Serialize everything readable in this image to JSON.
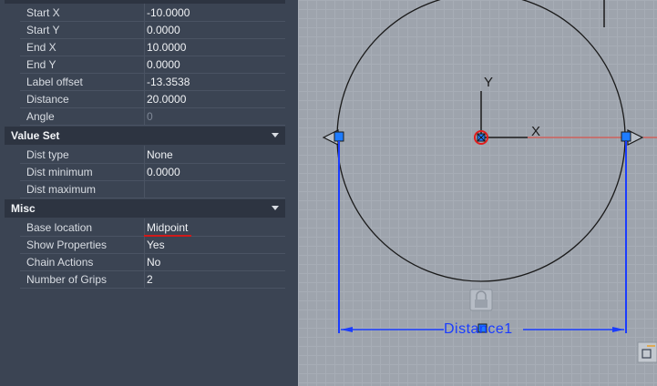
{
  "properties": {
    "rows_top": [
      {
        "label": "Start X",
        "value": "-10.0000"
      },
      {
        "label": "Start Y",
        "value": "0.0000"
      },
      {
        "label": "End X",
        "value": "10.0000"
      },
      {
        "label": "End Y",
        "value": "0.0000"
      },
      {
        "label": "Label offset",
        "value": "-13.3538"
      },
      {
        "label": "Distance",
        "value": "20.0000"
      },
      {
        "label": "Angle",
        "value": "0"
      }
    ],
    "value_set": {
      "title": "Value Set",
      "rows": [
        {
          "label": "Dist type",
          "value": "None"
        },
        {
          "label": "Dist minimum",
          "value": "0.0000"
        },
        {
          "label": "Dist maximum",
          "value": ""
        }
      ]
    },
    "misc": {
      "title": "Misc",
      "rows": [
        {
          "label": "Base location",
          "value": "Midpoint"
        },
        {
          "label": "Show Properties",
          "value": "Yes"
        },
        {
          "label": "Chain Actions",
          "value": "No"
        },
        {
          "label": "Number of Grips",
          "value": "2"
        }
      ]
    }
  },
  "canvas": {
    "dimension_label": "Distance1",
    "axis_y_label": "Y",
    "axis_x_label": "X",
    "colors": {
      "dimension": "#1a3cff",
      "grip": "#1e7cff",
      "axis_red": "#e23b2f",
      "circle": "#1a1a1a"
    }
  }
}
